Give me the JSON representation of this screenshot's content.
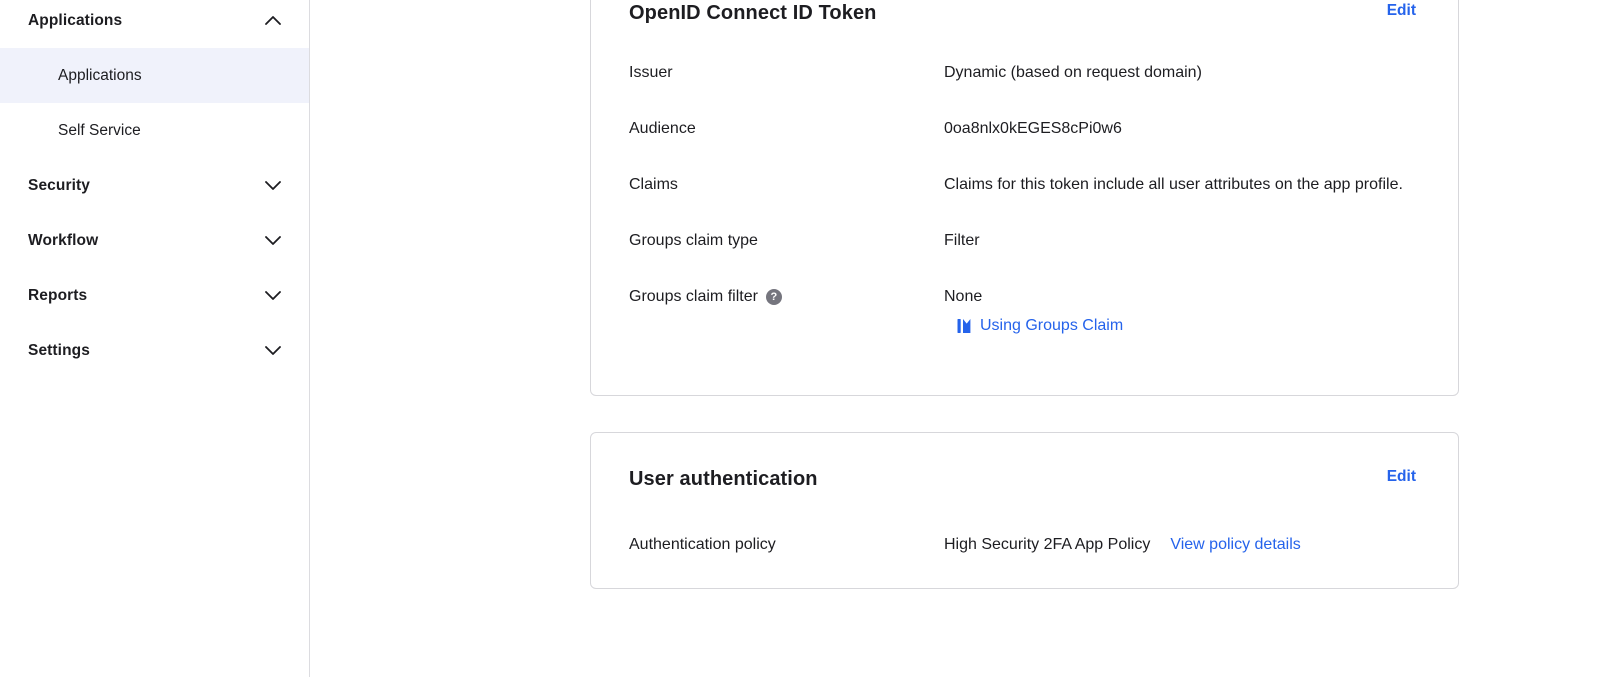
{
  "sidebar": {
    "items": [
      {
        "label": "Applications",
        "type": "section",
        "chevron": "up",
        "expanded": true
      },
      {
        "label": "Applications",
        "type": "sub",
        "selected": true
      },
      {
        "label": "Self Service",
        "type": "sub",
        "selected": false
      },
      {
        "label": "Security",
        "type": "section",
        "chevron": "down"
      },
      {
        "label": "Workflow",
        "type": "section",
        "chevron": "down"
      },
      {
        "label": "Reports",
        "type": "section",
        "chevron": "down"
      },
      {
        "label": "Settings",
        "type": "section",
        "chevron": "down"
      }
    ]
  },
  "cards": {
    "oidc": {
      "title": "OpenID Connect ID Token",
      "edit": "Edit",
      "rows": [
        {
          "label": "Issuer",
          "value": "Dynamic (based on request domain)"
        },
        {
          "label": "Audience",
          "value": "0oa8nlx0kEGES8cPi0w6"
        },
        {
          "label": "Claims",
          "value": "Claims for this token include all user attributes on the app profile."
        },
        {
          "label": "Groups claim type",
          "value": "Filter"
        },
        {
          "label": "Groups claim filter",
          "value": "None",
          "help": "?",
          "link": "Using Groups Claim",
          "link_icon": "book-icon"
        }
      ]
    },
    "auth": {
      "title": "User authentication",
      "edit": "Edit",
      "rows": [
        {
          "label": "Authentication policy",
          "value": "High Security 2FA App Policy",
          "link": "View policy details"
        }
      ]
    }
  },
  "colors": {
    "link_blue": "#2563eb",
    "text": "#1d1d21",
    "selected_item_bg": "#f0f2fb",
    "card_border": "#d7d7db",
    "help_icon_bg": "#75757e"
  }
}
